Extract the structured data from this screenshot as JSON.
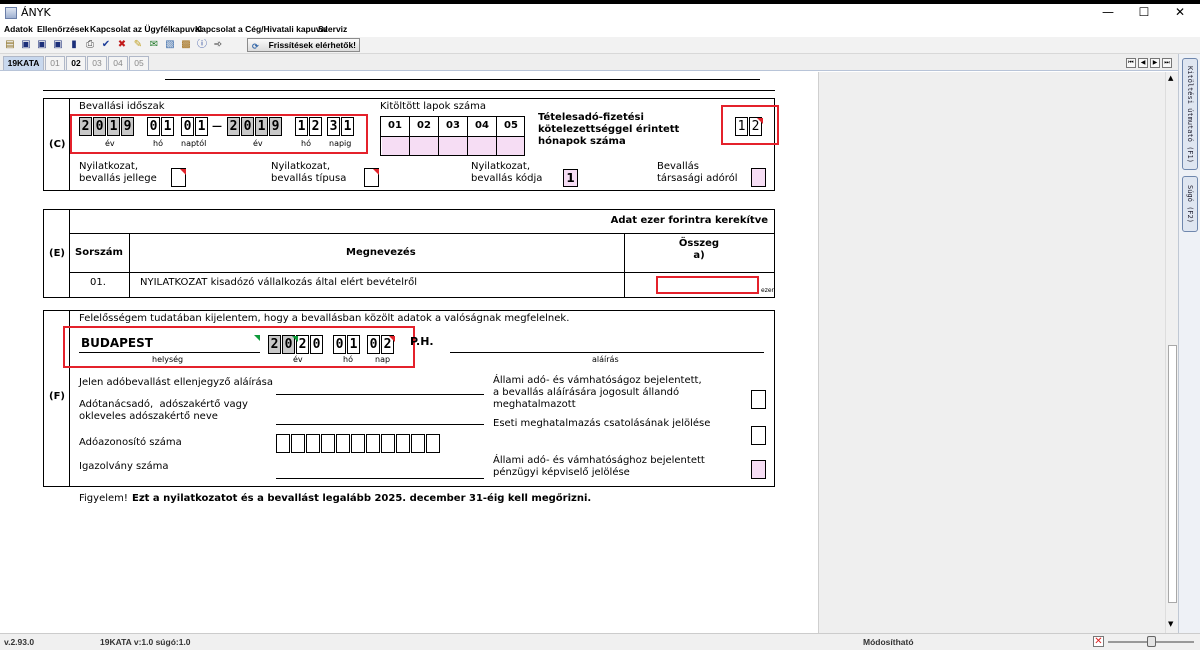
{
  "window": {
    "title": "ÁNYK",
    "minimize": "—",
    "maximize": "☐",
    "close": "✕"
  },
  "menu": [
    "Adatok",
    "Ellenőrzések",
    "Kapcsolat az Ügyfélkapuval",
    "Kapcsolat a Cég/Hivatali kapuval",
    "Szerviz"
  ],
  "toolbar": {
    "update_button": "Frissítések elérhetők!"
  },
  "tabs": [
    "19KATA",
    "01",
    "02",
    "03",
    "04",
    "05"
  ],
  "side_buttons": [
    "Kitöltési útmutató (F1)",
    "Súgó (F2)"
  ],
  "section_c": {
    "label": "(C)",
    "period_label": "Bevallási időszak",
    "from_year": [
      "2",
      "0",
      "1",
      "9"
    ],
    "from_month": [
      "0",
      "1"
    ],
    "from_day": [
      "0",
      "1"
    ],
    "dash": "—",
    "to_year": [
      "2",
      "0",
      "1",
      "9"
    ],
    "to_month": [
      "1",
      "2"
    ],
    "to_day": [
      "3",
      "1"
    ],
    "cap_ev": "év",
    "cap_ho": "hó",
    "cap_naptol": "naptól",
    "cap_napig": "napig",
    "pages_label": "Kitöltött lapok száma",
    "pages": [
      "01",
      "02",
      "03",
      "04",
      "05"
    ],
    "months_label": "Tételesadó-fizetési kötelezettséggel érintett hónapok száma",
    "months_value": [
      "1",
      "2"
    ],
    "jellege_label": "Nyilatkozat,\nbevallás jellege",
    "tipusa_label": "Nyilatkozat,\nbevallás típusa",
    "kodja_label": "Nyilatkozat,\nbevallás kódja",
    "kodja_value": "1",
    "tarsasagi_label": "Bevallás\ntársasági adóról"
  },
  "section_e": {
    "label": "(E)",
    "header_note": "Adat ezer forintra kerekítve",
    "col_sorszam": "Sorszám",
    "col_megnevezes": "Megnevezés",
    "col_osszeg": "Összeg\na)",
    "row_num": "01.",
    "row_text": "NYILATKOZAT kisadózó vállalkozás által elért bevételről",
    "unit": "ezer"
  },
  "section_f": {
    "label": "(F)",
    "declaration": "Felelősségem tudatában kijelentem, hogy a bevallásban közölt adatok a valóságnak megfelelnek.",
    "city": "BUDAPEST",
    "year": [
      "2",
      "0",
      "2",
      "0"
    ],
    "month": [
      "0",
      "1"
    ],
    "day": [
      "0",
      "2"
    ],
    "ph": "P.H.",
    "cap_helyseg": "helység",
    "cap_ev": "év",
    "cap_ho": "hó",
    "cap_nap": "nap",
    "cap_alairas": "aláírás",
    "countersign_label": "Jelen adóbevallást ellenjegyző aláírása",
    "advisor_label": "Adótanácsadó,  adószakértő vagy\nokleveles adószakértő neve",
    "taxid_label": "Adóazonosító száma",
    "license_label": "Igazolvány száma",
    "state_rep_label": "Állami adó- és vámhatóságoz bejelentett,\na bevallás aláírására jogosult állandó\nmeghatalmazott",
    "occasional_label": "Eseti meghatalmazás csatolásának jelölése",
    "fin_rep_label": "Állami adó- és vámhatósághoz bejelentett\npénzügyi képviselő jelölése"
  },
  "notice": {
    "prefix": "Figyelem!",
    "text": "Ezt a nyilatkozatot és a bevallást legalább 2025. december 31-éig kell megőrizni."
  },
  "status": {
    "version": "v.2.93.0",
    "form": "19KATA v:1.0 súgó:1.0",
    "mode": "Módosítható"
  },
  "colors": {
    "highlight": "#e4212b",
    "pink_field": "#f6ddf4",
    "grey_digit": "#c8c8c8"
  }
}
